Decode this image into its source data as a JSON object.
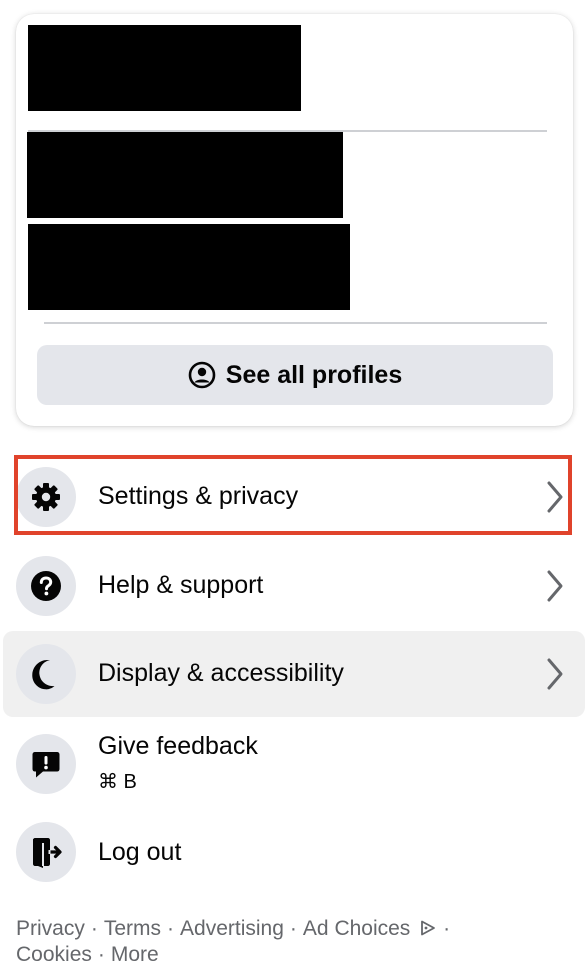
{
  "profiles_card": {
    "see_all_label": "See all profiles"
  },
  "menu": {
    "items": [
      {
        "label": "Settings & privacy",
        "icon": "gear-icon"
      },
      {
        "label": "Help & support",
        "icon": "question-icon"
      },
      {
        "label": "Display & accessibility",
        "icon": "moon-icon"
      },
      {
        "label": "Give feedback",
        "shortcut": "⌘ B",
        "icon": "feedback-icon"
      },
      {
        "label": "Log out",
        "icon": "logout-icon"
      }
    ]
  },
  "footer": {
    "links": [
      "Privacy",
      "Terms",
      "Advertising",
      "Ad Choices",
      "Cookies",
      "More"
    ],
    "separator": "·"
  },
  "colors": {
    "highlight_border": "#e0432b",
    "icon_circle_bg": "#e4e6eb",
    "button_bg": "#e4e6eb",
    "active_row_bg": "#f0f0f0",
    "secondary_text": "#65676b"
  }
}
